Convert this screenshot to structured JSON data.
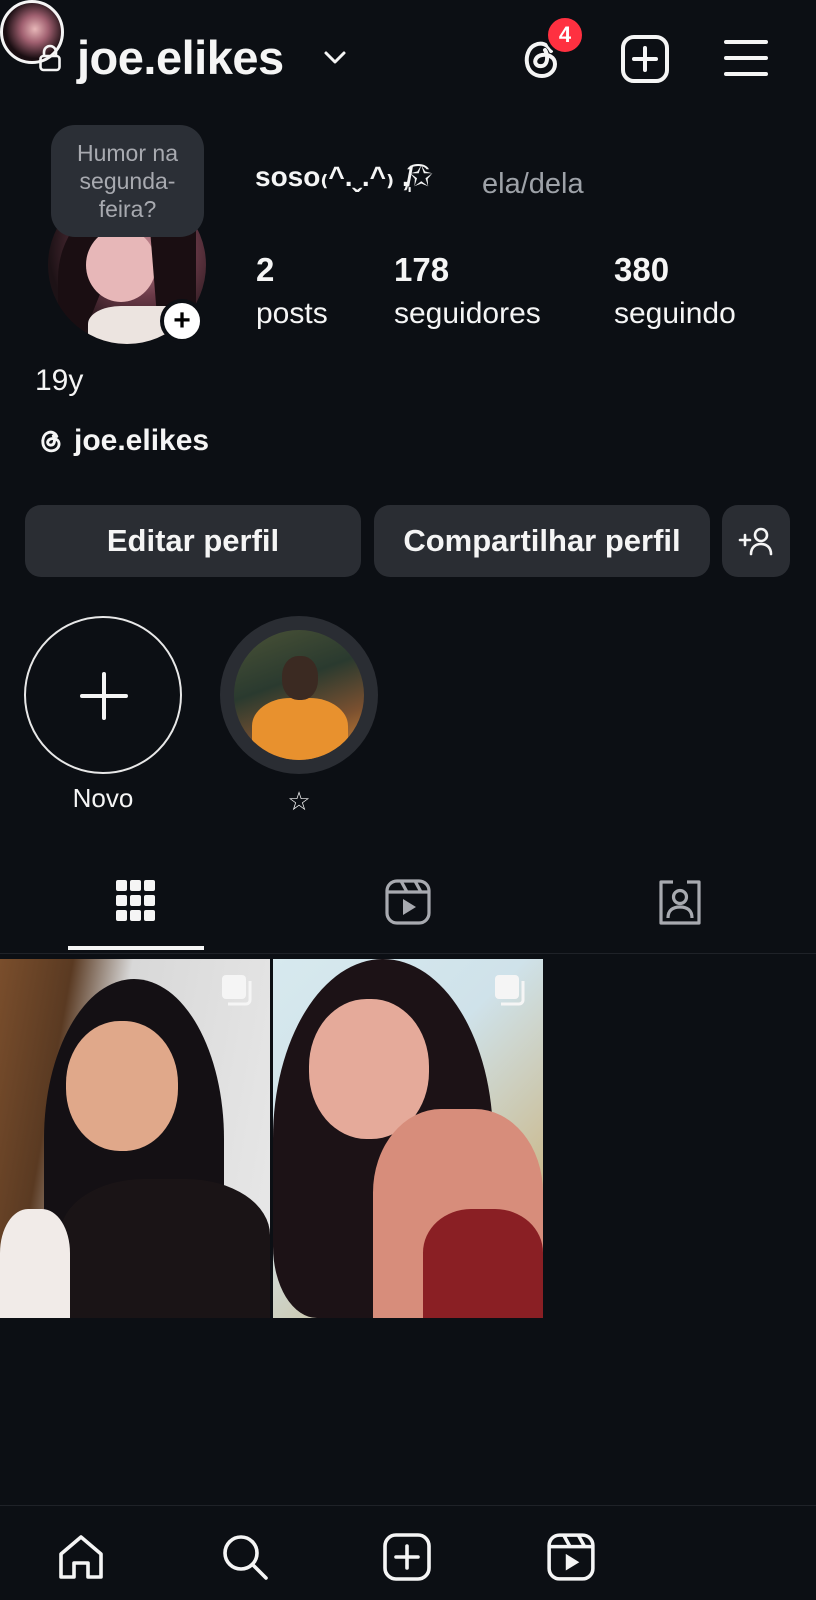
{
  "header": {
    "username": "joe.elikes",
    "threads_badge_count": "4"
  },
  "profile": {
    "note": "Humor na segunda-feira?",
    "full_name": "soso₍^.ˬ.^₎ ,̸̩͡✩",
    "pronouns": "ela/dela",
    "stats": [
      {
        "value": "2",
        "label": "posts"
      },
      {
        "value": "178",
        "label": "seguidores"
      },
      {
        "value": "380",
        "label": "seguindo"
      }
    ],
    "bio": "19y",
    "threads_handle": "joe.elikes"
  },
  "actions": {
    "edit_label": "Editar perfil",
    "share_label": "Compartilhar perfil"
  },
  "highlights": [
    {
      "label": "Novo"
    },
    {
      "label": "☆"
    }
  ],
  "tabs": [
    {
      "icon": "grid-icon",
      "active": true
    },
    {
      "icon": "reels-icon",
      "active": false
    },
    {
      "icon": "tagged-icon",
      "active": false
    }
  ],
  "posts": [
    {
      "type": "carousel"
    },
    {
      "type": "carousel"
    }
  ],
  "bottom_nav": [
    "home-icon",
    "search-icon",
    "create-icon",
    "reels-icon",
    "profile-avatar"
  ],
  "colors": {
    "background": "#0c0f14",
    "button": "#2a2d33",
    "badge": "#ff3040",
    "muted_text": "#9ea2a8"
  }
}
